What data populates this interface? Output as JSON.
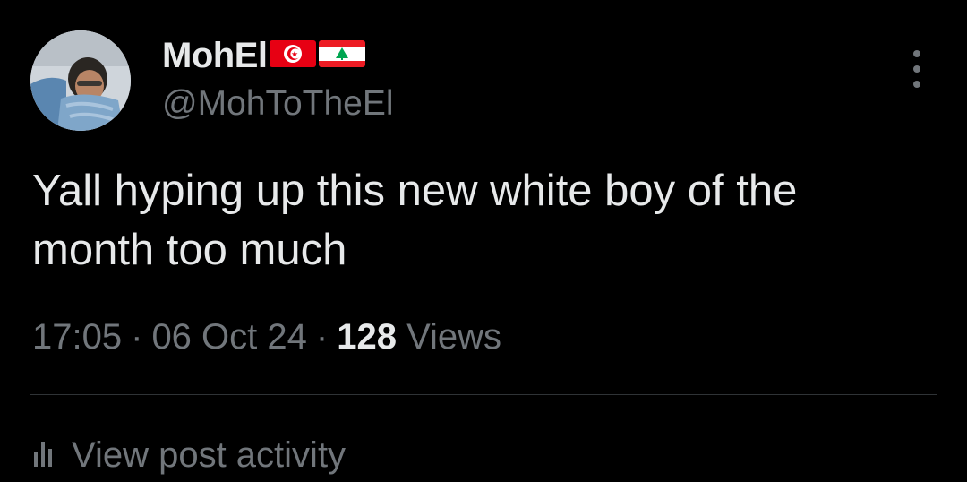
{
  "author": {
    "display_name": "MohEl",
    "flags": [
      "tunisia-flag",
      "lebanon-flag"
    ],
    "handle": "@MohToTheEl"
  },
  "post": {
    "text": "Yall hyping up this new white boy of the\nmonth too much",
    "time": "17:05",
    "date": "06 Oct 24",
    "separator": "·",
    "views_count": "128",
    "views_label": "Views"
  },
  "actions": {
    "view_activity_label": "View post activity",
    "more_icon": "more-vertical-icon",
    "activity_icon": "bar-chart-icon"
  },
  "colors": {
    "background": "#000000",
    "text_primary": "#e7e9ea",
    "text_secondary": "#71767b",
    "divider": "#2f3336"
  }
}
